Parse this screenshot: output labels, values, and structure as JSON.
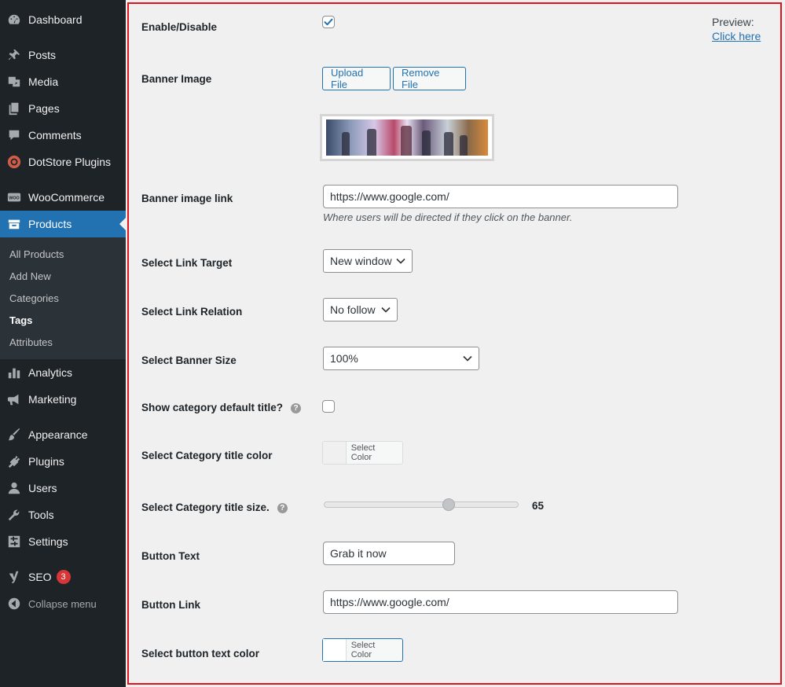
{
  "sidebar": {
    "items": [
      {
        "label": "Dashboard",
        "icon": "dashboard-icon"
      },
      {
        "label": "Posts",
        "icon": "pin-icon"
      },
      {
        "label": "Media",
        "icon": "media-icon"
      },
      {
        "label": "Pages",
        "icon": "pages-icon"
      },
      {
        "label": "Comments",
        "icon": "comments-icon"
      },
      {
        "label": "DotStore Plugins",
        "icon": "dotstore-icon"
      },
      {
        "label": "WooCommerce",
        "icon": "woo-icon"
      },
      {
        "label": "Products",
        "icon": "products-icon"
      },
      {
        "label": "Analytics",
        "icon": "analytics-icon"
      },
      {
        "label": "Marketing",
        "icon": "megaphone-icon"
      },
      {
        "label": "Appearance",
        "icon": "brush-icon"
      },
      {
        "label": "Plugins",
        "icon": "plug-icon"
      },
      {
        "label": "Users",
        "icon": "users-icon"
      },
      {
        "label": "Tools",
        "icon": "wrench-icon"
      },
      {
        "label": "Settings",
        "icon": "settings-icon"
      },
      {
        "label": "SEO",
        "icon": "yoast-icon",
        "badge": "3"
      }
    ],
    "submenu": [
      "All Products",
      "Add New",
      "Categories",
      "Tags",
      "Attributes"
    ],
    "current_sub": "Tags",
    "collapse_label": "Collapse menu",
    "active_color": "#2271b1"
  },
  "form": {
    "enable_label": "Enable/Disable",
    "enable_checked": true,
    "preview_label": "Preview:",
    "preview_link": "Click here",
    "banner_image_label": "Banner Image",
    "upload_label": "Upload File",
    "remove_label": "Remove File",
    "banner_link_label": "Banner image link",
    "banner_link_value": "https://www.google.com/",
    "banner_link_desc": "Where users will be directed if they click on the banner.",
    "link_target_label": "Select Link Target",
    "link_target_value": "New window",
    "link_relation_label": "Select Link Relation",
    "link_relation_value": "No follow",
    "banner_size_label": "Select Banner Size",
    "banner_size_value": "100%",
    "show_title_label": "Show category default title?",
    "show_title_checked": false,
    "help_glyph": "?",
    "title_color_label": "Select Category title color",
    "select_color_text": "Select Color",
    "title_size_label": "Select Category title size.",
    "title_size_value": "65",
    "title_size_fraction": 0.65,
    "button_text_label": "Button Text",
    "button_text_value": "Grab it now",
    "button_link_label": "Button Link",
    "button_link_value": "https://www.google.com/",
    "button_text_color_label": "Select button text color",
    "highlight_border_color": "#e0141c"
  }
}
